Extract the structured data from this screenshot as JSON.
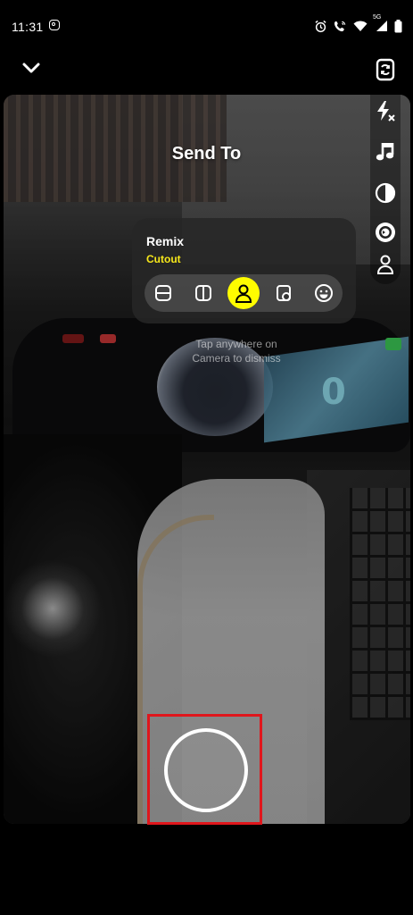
{
  "status_bar": {
    "time": "11:31",
    "icons": [
      "instagram-icon",
      "alarm-icon",
      "wifi-call-icon",
      "wifi-icon",
      "signal-5g-icon",
      "battery-icon"
    ],
    "network_label": "5G"
  },
  "header": {
    "collapse_icon": "chevron-down-icon",
    "title": "Send To"
  },
  "right_rail": {
    "items": [
      "flip-camera-icon",
      "flash-off-icon",
      "music-note-icon",
      "contrast-icon",
      "lens-icon",
      "person-icon"
    ]
  },
  "remix_panel": {
    "title": "Remix",
    "subtitle": "Cutout",
    "subtitle_color": "#f7e81a",
    "layouts": [
      "top-bottom-split-icon",
      "side-by-side-split-icon",
      "cutout-person-icon",
      "picture-in-picture-icon",
      "face-icon"
    ],
    "selected_layout": "cutout-person-icon",
    "selected_color": "#fffc00"
  },
  "camera": {
    "dismiss_hint_line1": "Tap anywhere on",
    "dismiss_hint_line2": "Camera to dismiss",
    "capture_button": "capture-button",
    "highlight_color": "#e0161c"
  }
}
